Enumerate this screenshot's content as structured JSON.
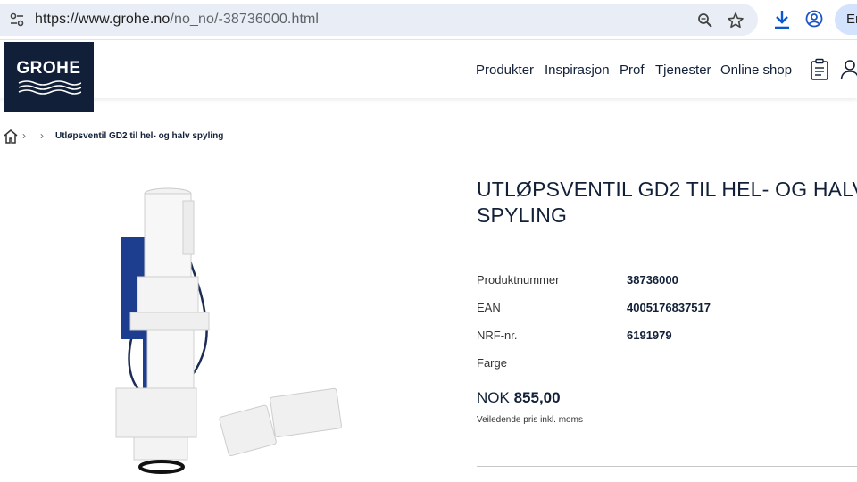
{
  "browser": {
    "url_host": "https://www.grohe.no",
    "url_path": "/no_no/-38736000.html",
    "lang_button": "En"
  },
  "header": {
    "logo_text": "GROHE",
    "nav": [
      "Produkter",
      "Inspirasjon",
      "Prof",
      "Tjenester",
      "Online shop"
    ]
  },
  "breadcrumb": {
    "current": "Utløpsventil GD2 til hel- og halv spyling"
  },
  "product": {
    "title": "UTLØPSVENTIL GD2 TIL HEL- OG HALV SPYLING",
    "specs": [
      {
        "label": "Produktnummer",
        "value": "38736000"
      },
      {
        "label": "EAN",
        "value": "4005176837517"
      },
      {
        "label": "NRF-nr.",
        "value": "6191979"
      },
      {
        "label": "Farge",
        "value": ""
      }
    ],
    "price_currency": "NOK",
    "price_amount": "855,00",
    "price_note": "Veiledende pris inkl. moms"
  },
  "colors": {
    "brand_navy": "#112038",
    "omnibox_bg": "#e9eef6",
    "lang_pill_bg": "#d3e3fd",
    "download_blue": "#0b57d0"
  }
}
